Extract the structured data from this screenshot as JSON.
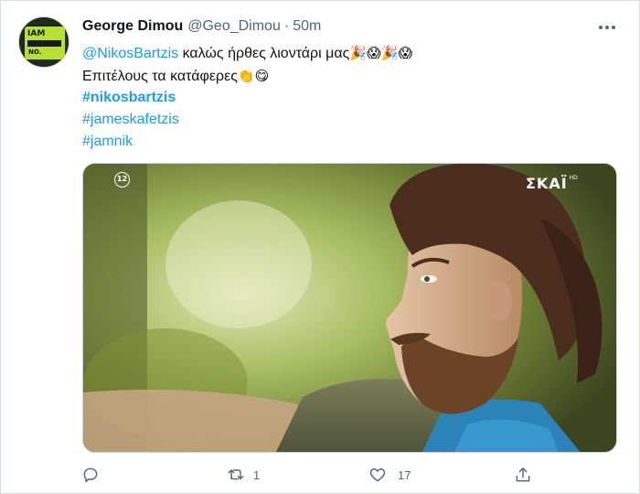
{
  "author": {
    "name": "George Dimou",
    "handle": "@Geo_Dimou",
    "separator": "·",
    "time": "50m",
    "avatar_text_top": "IAM",
    "avatar_text_bottom": "NO."
  },
  "tweet": {
    "mention": "@NikosBartzis",
    "line1_text": " καλώς ήρθες λιοντάρι μας",
    "line1_emoji": "🎉😱🎉😱",
    "line2_text": "Επιτέλους τα κατάφερες",
    "line2_emoji": "👏😋",
    "hashtags": [
      "#nikosbartzis",
      "#jameskafetzis",
      "#jamnik"
    ]
  },
  "media": {
    "rating_badge": "12",
    "channel_logo": "ΣΚΑΪ",
    "channel_logo_sup": "HD"
  },
  "actions": {
    "reply_icon": "reply-icon",
    "retweet_icon": "retweet-icon",
    "retweet_count": "1",
    "like_icon": "heart-icon",
    "like_count": "17",
    "share_icon": "share-icon"
  },
  "colors": {
    "link": "#1d9bf0",
    "secondary_text": "#536471",
    "primary_text": "#0f1419"
  }
}
